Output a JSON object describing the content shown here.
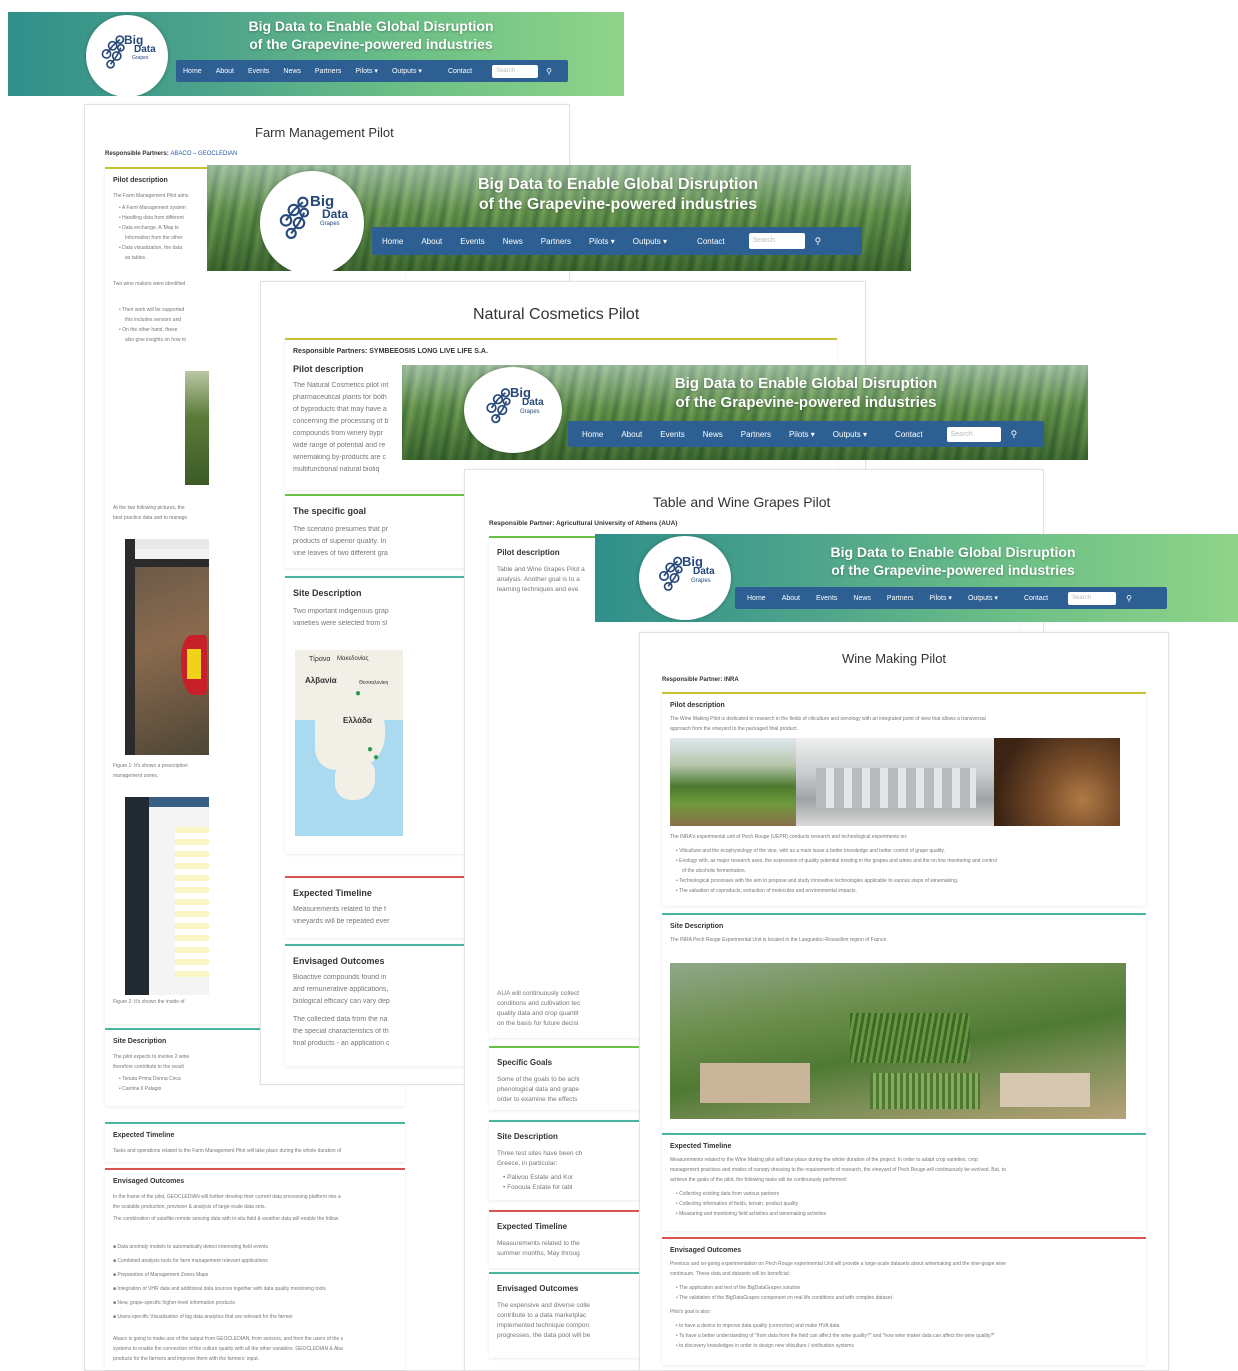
{
  "banner": {
    "title_line1": "Big Data to Enable Global Disruption",
    "title_line2": "of the Grapevine-powered industries",
    "logo_big": "Big",
    "logo_data": "Data",
    "logo_grapes": "Grapes",
    "nav": [
      "Home",
      "About",
      "Events",
      "News",
      "Partners",
      "Pilots ▾",
      "Outputs ▾",
      "Contact"
    ],
    "search_placeholder": "Search"
  },
  "farm": {
    "title": "Farm Management Pilot",
    "resp_label": "Responsible Partners:",
    "resp_value": "ABACO – GEOCLEDIAN",
    "pilot_desc_heading": "Pilot description",
    "desc_intro": "The Farm Management Pilot aims",
    "bullets1": [
      "A Farm Management system",
      "Handling data from different",
      "Data exchange. A 'Map to",
      "Information from the other",
      "Data visualization, the data",
      "as tables."
    ],
    "winemakers": "Two wine makers were identified",
    "bullets2": [
      "Their work will be supported",
      "this includes sensors and",
      "On the other hand, these",
      "also give insights on how to"
    ],
    "pictures_text": "At the two following pictures, the",
    "pictures_text2": "best practice data and to manage",
    "figure1": "Figure 1: It's shown a prescription",
    "figure1b": "management zones.",
    "figure2": "Figure 2: It's shown the inside of",
    "site_heading": "Site Description",
    "site_text1": "The pilot expects to involve 2 wine",
    "site_text2": "therefore contribute to the result",
    "site_bullets": [
      "Tenuta Prima Donna Circa",
      "Cantina Il Palagio"
    ],
    "timeline_heading": "Expected Timeline",
    "timeline_text": "Tasks and operations related to the Farm Management Pilot will take place during the whole duration of",
    "outcomes_heading": "Envisaged Outcomes",
    "outcomes_text1": "In the frame of the pilot, GEOCLEDIAN will further develop their current data processing platform into a",
    "outcomes_text2": "the scalable production, provision & analysis of large-scale data sets.",
    "outcomes_text3": "The combination of satellite remote sensing data with in-situ field & weather data will enable the follow",
    "outcomes_bullets": [
      "Data anomaly models to automatically detect interesting field events",
      "Combined analysis tools for farm management relevant applications",
      "Preparation of Management Zones Maps",
      "Integration of VHR data and additional data sources together with data quality monitoring tools",
      "New, grape-specific higher-level information products",
      "Users-specific Visualization of big data analytics that are relevant for the farmer"
    ],
    "closing1": "Abaco is going to make use of the output from GEOCLEDIAN, from sensors, and from the users of the s",
    "closing2": "systems to enable the connection of the culture quality with all the other variables. GEOCLEDIAN & Aba",
    "closing3": "products for the farmers and improve them with the farmers' input."
  },
  "cosmetics": {
    "title": "Natural Cosmetics Pilot",
    "resp_label": "Responsible Partners:",
    "resp_value": "SYMBEEOSIS LONG LIVE LIFE S.A.",
    "pilot_desc_heading": "Pilot description",
    "desc_lines": [
      "The Natural Cosmetics pilot int",
      "pharmaceutical plants for both",
      "of byproducts that may have a",
      "concerning the processing of b",
      "compounds from winery bypr",
      "wide range of potential and re",
      "winemaking by-products are c",
      "multifunctional natural bioliq"
    ],
    "goal_heading": "The specific goal",
    "goal_lines": [
      "The scenario presumes that pr",
      "products of superior quality. In",
      "vine leaves of two different gra"
    ],
    "site_heading": "Site Description",
    "site_lines": [
      "Two important indigenous grap",
      "varieties were selected from sl"
    ],
    "map_labels": [
      "Τίρανα",
      "Μακεδονίας",
      "Αλβανία",
      "Ελλάδα",
      "Θεσσαλονίκη"
    ],
    "timeline_heading": "Expected Timeline",
    "timeline_lines": [
      "Measurements related to the f",
      "vineyards will be repeated ever"
    ],
    "outcomes_heading": "Envisaged Outcomes",
    "outcomes_lines": [
      "Bioactive compounds found in",
      "and remunerative applications,",
      "biological efficacy can vary dep"
    ],
    "outcomes_lines2": [
      "The collected data from the na",
      "the special characteristics of th",
      "final products - an application c"
    ]
  },
  "table": {
    "title": "Table and Wine Grapes Pilot",
    "resp_label": "Responsible Partner:",
    "resp_value": "Agricultural University of Athens (AUA)",
    "pilot_desc_heading": "Pilot description",
    "desc_lines": [
      "Table and Wine Grapes Pilot a",
      "analysis. Another goal is to a",
      "learning techniques and eve"
    ],
    "aua_lines": [
      "AUA will continuously collect",
      "conditions and cultivation tec",
      "quality data and crop quantit",
      "on the basis for future decisi"
    ],
    "goals_heading": "Specific Goals",
    "goals_lines": [
      "Some of the goals to be achi",
      "phenological data and grape",
      "order to examine the effects"
    ],
    "site_heading": "Site Description",
    "site_lines": [
      "Three test sites have been ch",
      "Greece, in particular:"
    ],
    "site_bullets": [
      "Palivou Estate and Kor",
      "Foooula Estate for tabl"
    ],
    "timeline_heading": "Expected Timeline",
    "timeline_lines": [
      "Measurements related to the",
      "summer months, May throug"
    ],
    "outcomes_heading": "Envisaged Outcomes",
    "outcomes_lines": [
      "The expensive and diverse colle",
      "contribute to a data marketplac",
      "implemented technique compon",
      "progresses, the data pool will be"
    ]
  },
  "winemaking": {
    "title": "Wine Making Pilot",
    "resp_label": "Responsible Partner:",
    "resp_value": "INRA",
    "pilot_desc_heading": "Pilot description",
    "desc_line1": "The Wine Making Pilot is dedicated to research in the fields of viticulture and oenology with an integrated point of view that allows a transversal",
    "desc_line2": "approach from the vineyard to the packaged final product.",
    "inra_text": "The INRA's experimental unit of Pech Rouge (UEPR) conducts research and technological experiments on:",
    "inra_bullets": [
      "Viticulture and the ecophysiology of the vine, with as a main issue a better knowledge and better control of grape quality.",
      "Enology with, as major research axes, the expression of quality potential existing in the grapes and wines and the on line monitoring and control",
      "of the alcoholic fermentation.",
      "Technological processes with the aim to propose and study innovative technologies applicable to various steps of winemaking.",
      "The valuation of coproducts, extraction of molecules and environmental impacts."
    ],
    "site_heading": "Site Description",
    "site_text": "The INRA Pech Rouge Experimental Unit is located in the Languedoc-Roussillon region of France.",
    "timeline_heading": "Expected Timeline",
    "timeline_lines": [
      "Measurements related to the Wine Making pilot will take place during the whole duration of the project. In order to adapt crop varieties, crop",
      "management practices and modes of canopy dressing to the requirements of research, the vineyard of Pech Rouge will continuously be evolved. But, to",
      "achieve the goals of the pilot, the following tasks will be continuously performed:"
    ],
    "timeline_bullets": [
      "Collecting existing data from various partners",
      "Collecting information of fields, terrain, product quality",
      "Measuring and monitoring field activities and winemaking activities"
    ],
    "outcomes_heading": "Envisaged Outcomes",
    "outcomes_line1": "Previous and on-going experimentation on Pech Rouge experimental Unit will provide a large-scale datasets about winemaking and the vine-grape wine",
    "outcomes_line2": "continuum. These data and datasets will be beneficial:",
    "outcomes_bullets": [
      "The application and test of the BigDataGrapes solution",
      "The validation of the BigDataGrapes component on real life conditions and with complex dataset."
    ],
    "goal_label": "Pilot's goal is also:",
    "goal_bullets": [
      "to have a device to improve data quality (correction) and make HVA data",
      "To have a better understanding of \"from data from the field can affect the wine quality?\" and \"how wine maker data can affect the wine quality?\"",
      "to discovery knowledges in order to design new viticulture / vinification systems"
    ]
  }
}
